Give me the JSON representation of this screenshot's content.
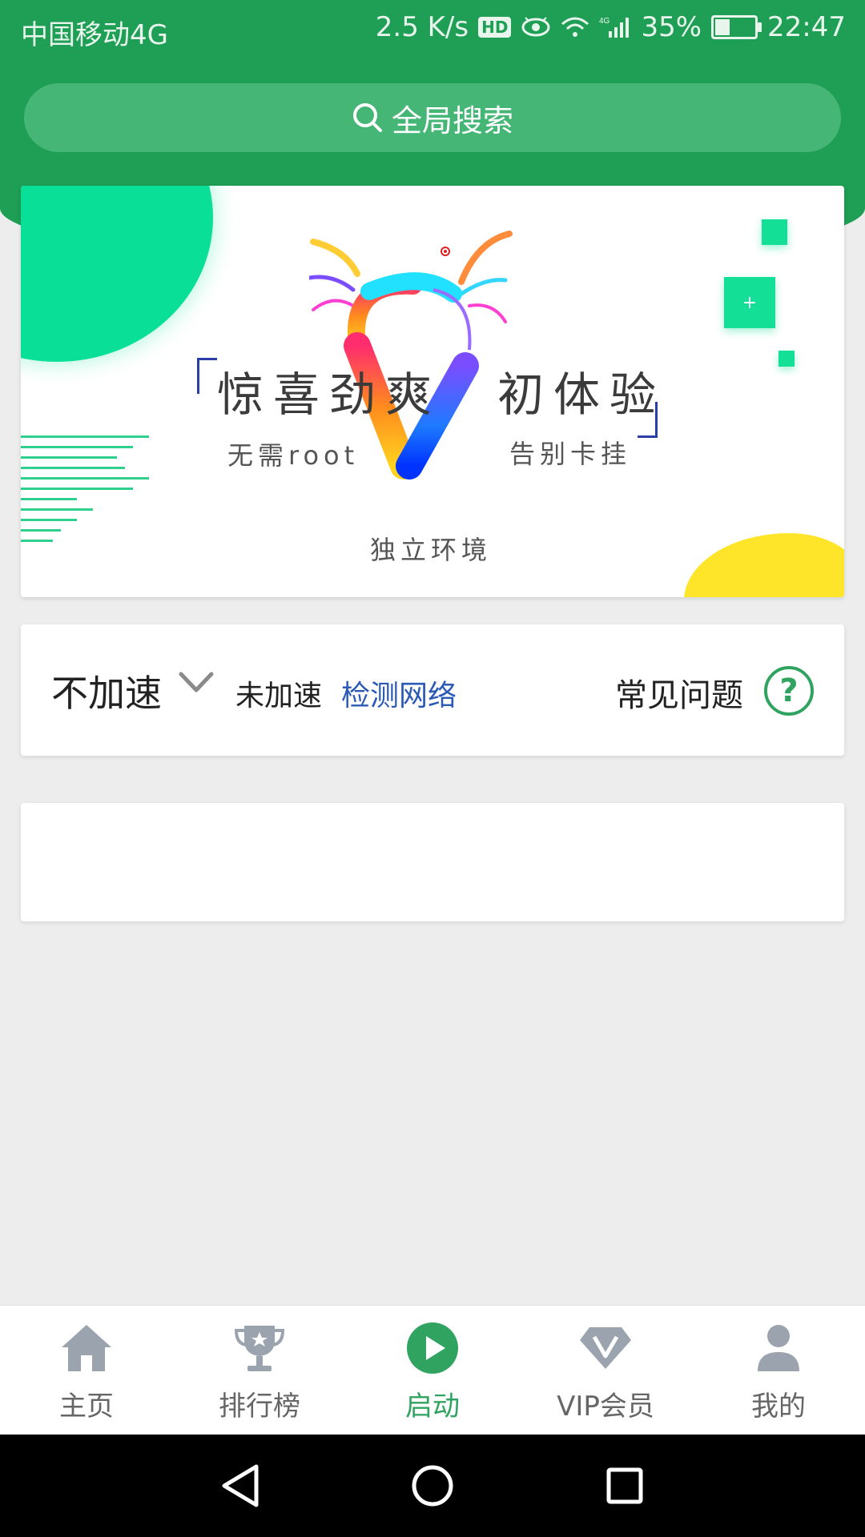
{
  "status_bar": {
    "carrier": "中国移动4G",
    "net_speed": "2.5 K/s",
    "hd": "HD",
    "network_type": "4G",
    "battery": "35%",
    "time": "22:47"
  },
  "search": {
    "label": "全局搜索"
  },
  "banner": {
    "headline": "惊喜劲爽　初体验",
    "sub_left": "无需root",
    "sub_right": "告别卡挂",
    "sub_bottom": "独立环境",
    "plus": "+"
  },
  "accel": {
    "mode": "不加速",
    "state": "未加速",
    "detect": "检测网络",
    "faq": "常见问题",
    "help_glyph": "?"
  },
  "bottom_nav": {
    "items": [
      {
        "label": "主页",
        "icon": "home-icon"
      },
      {
        "label": "排行榜",
        "icon": "trophy-icon"
      },
      {
        "label": "启动",
        "icon": "play-icon",
        "active": true
      },
      {
        "label": "VIP会员",
        "icon": "diamond-icon"
      },
      {
        "label": "我的",
        "icon": "user-icon"
      }
    ]
  },
  "colors": {
    "header": "#1f9e55",
    "accent": "#2fa35f",
    "link": "#2b59b6",
    "background": "#ededed"
  }
}
